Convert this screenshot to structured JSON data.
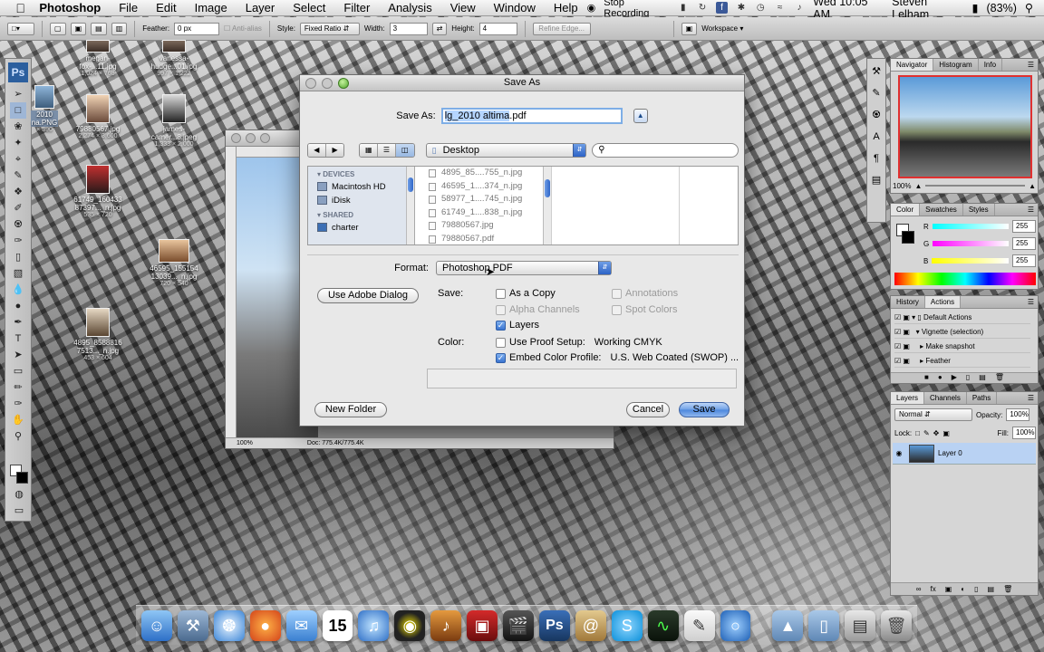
{
  "menubar": {
    "apple": "",
    "app_name": "Photoshop",
    "items": [
      "File",
      "Edit",
      "Image",
      "Layer",
      "Select",
      "Filter",
      "Analysis",
      "View",
      "Window",
      "Help"
    ],
    "stop_recording": "Stop Recording",
    "datetime": "Wed 10:05 AM",
    "user": "Steven Lelham",
    "battery": "(83%)"
  },
  "options_bar": {
    "feather_label": "Feather:",
    "feather_value": "0 px",
    "anti_alias": "Anti-alias",
    "style_label": "Style:",
    "style_value": "Fixed Ratio",
    "width_label": "Width:",
    "width_value": "3",
    "height_label": "Height:",
    "height_value": "4",
    "refine_edge": "Refine Edge...",
    "workspace": "Workspace"
  },
  "toolbox": {
    "logo": "Ps"
  },
  "desktop_icons": [
    {
      "name": "megan-\nfox-...11.jpg",
      "dim": "1,024 × 768"
    },
    {
      "name": "vanessa-\nhudge...01.jpg",
      "dim": "997 × 1,222"
    },
    {
      "name": "2010\nna.PNG",
      "dim": "× 390"
    },
    {
      "name": "79880567.jpg",
      "dim": "2,274 × 3,600"
    },
    {
      "name": "james-\ncamer...8.jpeg",
      "dim": "1,333 × 2,000"
    },
    {
      "name": "61749_160433\n87397..._n.jpg",
      "dim": "535 × 720"
    },
    {
      "name": "46595_155154\n13039..._n.jpg",
      "dim": "720 × 540"
    },
    {
      "name": "4895_8588816\n7513..._n.jpg",
      "dim": "453 × 604"
    }
  ],
  "document": {
    "zoom": "100%",
    "doc_size": "Doc: 775.4K/775.4K"
  },
  "dialog": {
    "title": "Save As",
    "save_as_label": "Save As:",
    "filename_selected": "lg_2010 altima",
    "filename_ext": ".pdf",
    "location": "Desktop",
    "search_placeholder": "",
    "sidebar": {
      "devices_header": "DEVICES",
      "devices": [
        "Macintosh HD",
        "iDisk"
      ],
      "shared_header": "SHARED",
      "shared": [
        "charter"
      ]
    },
    "files": [
      "4895_85....755_n.jpg",
      "46595_1....374_n.jpg",
      "58977_1....745_n.jpg",
      "61749_1....838_n.jpg",
      "79880567.jpg",
      "79880567.pdf"
    ],
    "format_label": "Format:",
    "format_value": "Photoshop PDF",
    "use_adobe_dialog": "Use Adobe Dialog",
    "save_label": "Save:",
    "options": {
      "as_a_copy": "As a Copy",
      "annotations": "Annotations",
      "alpha_channels": "Alpha Channels",
      "spot_colors": "Spot Colors",
      "layers": "Layers"
    },
    "color_label": "Color:",
    "use_proof_setup": "Use Proof Setup:",
    "proof_value": "Working CMYK",
    "embed_color_profile": "Embed Color Profile:",
    "profile_value": "U.S. Web Coated (SWOP) ...",
    "new_folder": "New Folder",
    "cancel": "Cancel",
    "save": "Save"
  },
  "navigator": {
    "tabs": [
      "Navigator",
      "Histogram",
      "Info"
    ],
    "zoom": "100%"
  },
  "color_panel": {
    "tabs": [
      "Color",
      "Swatches",
      "Styles"
    ],
    "r_label": "R",
    "r_value": "255",
    "g_label": "G",
    "g_value": "255",
    "b_label": "B",
    "b_value": "255"
  },
  "history_panel": {
    "tabs": [
      "History",
      "Actions"
    ],
    "items": [
      "Default Actions",
      "Vignette (selection)",
      "Make snapshot",
      "Feather"
    ]
  },
  "layers_panel": {
    "tabs": [
      "Layers",
      "Channels",
      "Paths"
    ],
    "blend_mode": "Normal",
    "opacity_label": "Opacity:",
    "opacity_value": "100%",
    "lock_label": "Lock:",
    "fill_label": "Fill:",
    "fill_value": "100%",
    "layer_name": "Layer 0"
  },
  "colors": {
    "accent": "#3a74d0",
    "selection": "#b5d5ff",
    "layer_selected": "#b9d2f3"
  }
}
